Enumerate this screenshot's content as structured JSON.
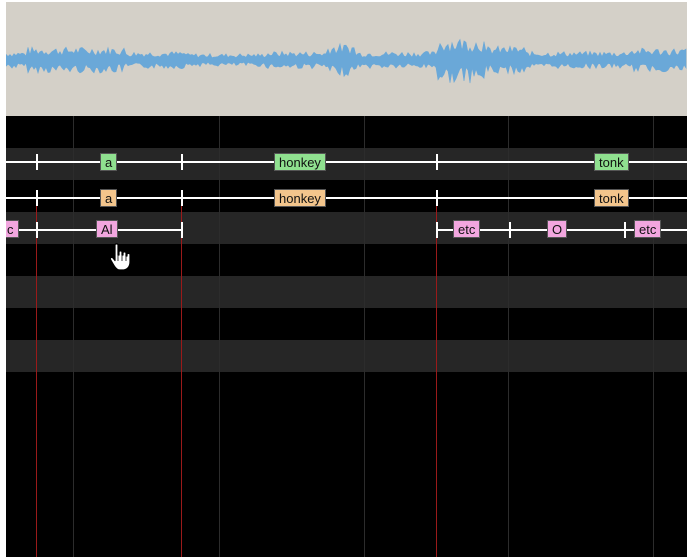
{
  "tiers": [
    {
      "name": "green-tier",
      "labels": [
        "a",
        "honkey",
        "tonk"
      ]
    },
    {
      "name": "orange-tier",
      "labels": [
        "a",
        "honkey",
        "tonk"
      ]
    },
    {
      "name": "pink-tier",
      "labels": [
        "c",
        "Al",
        "etc",
        "O",
        "etc"
      ]
    }
  ],
  "colors": {
    "green": "#8fe08f",
    "orange": "#f3c58c",
    "pink": "#f2a6df",
    "waveform": "#6aa8d8",
    "marker": "#9a1a1a",
    "panel": "#d4d0c8"
  },
  "cursor_icon": "hand-pointer-icon"
}
